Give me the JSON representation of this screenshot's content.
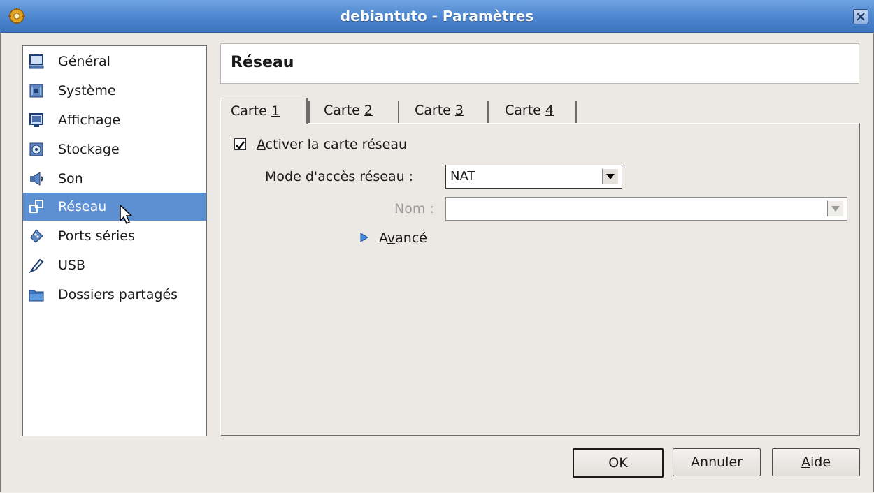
{
  "window": {
    "title": "debiantuto - Paramètres"
  },
  "sidebar": {
    "items": [
      {
        "label": "Général",
        "icon": "monitor-icon"
      },
      {
        "label": "Système",
        "icon": "chip-icon"
      },
      {
        "label": "Affichage",
        "icon": "display-icon"
      },
      {
        "label": "Stockage",
        "icon": "storage-icon"
      },
      {
        "label": "Son",
        "icon": "speaker-icon"
      },
      {
        "label": "Réseau",
        "icon": "network-icon",
        "selected": true
      },
      {
        "label": "Ports séries",
        "icon": "serial-port-icon"
      },
      {
        "label": "USB",
        "icon": "usb-icon"
      },
      {
        "label": "Dossiers partagés",
        "icon": "folder-icon"
      }
    ]
  },
  "section": {
    "title": "Réseau"
  },
  "tabs": [
    {
      "prefix": "Carte ",
      "mnemonic": "1",
      "active": true
    },
    {
      "prefix": "Carte ",
      "mnemonic": "2"
    },
    {
      "prefix": "Carte ",
      "mnemonic": "3"
    },
    {
      "prefix": "Carte ",
      "mnemonic": "4"
    }
  ],
  "adapter": {
    "enable_mnemonic": "A",
    "enable_rest": "ctiver la carte réseau",
    "enabled": true,
    "mode_mnemonic": "M",
    "mode_rest": "ode d'accès réseau :",
    "mode_value": "NAT",
    "name_mnemonic": "N",
    "name_rest": "om :",
    "name_value": "",
    "advanced_pre": "A",
    "advanced_mnemonic": "v",
    "advanced_rest": "ancé"
  },
  "buttons": {
    "ok": "OK",
    "cancel": "Annuler",
    "help_mnemonic": "A",
    "help_rest": "ide"
  },
  "colors": {
    "titlebar": "#4d86cf",
    "selection": "#5d8fd3",
    "background": "#ece9e4"
  }
}
